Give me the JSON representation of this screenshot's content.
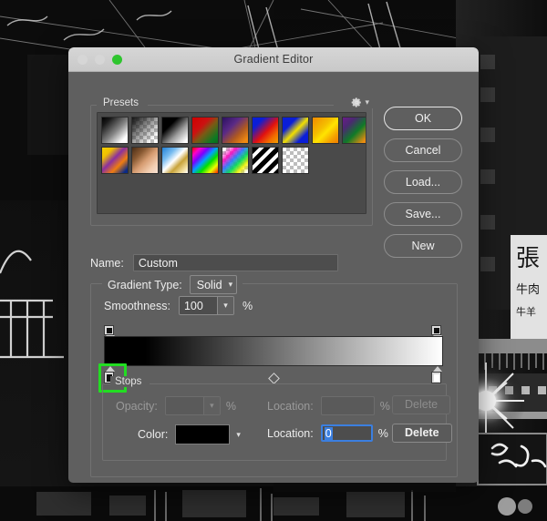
{
  "window": {
    "title": "Gradient Editor",
    "traffic_lights": [
      {
        "name": "close",
        "color": "#d6d6d6"
      },
      {
        "name": "minimize",
        "color": "#d6d6d6"
      },
      {
        "name": "maximize",
        "color": "#2ec52e"
      }
    ]
  },
  "presets": {
    "label": "Presets",
    "menu_icon": "gear-icon",
    "swatches": [
      {
        "name": "foreground-to-background",
        "css": "linear-gradient(135deg,#000 0%,#1a1a1a 18%,#888 55%,#fff 85%,#fff 100%)",
        "checker": false
      },
      {
        "name": "foreground-to-transparent",
        "css": "linear-gradient(135deg,#111 0%,rgba(60,60,60,0.55) 45%,rgba(255,255,255,0) 85%)",
        "checker": true
      },
      {
        "name": "black-white",
        "css": "linear-gradient(135deg,#000 0%,#000 30%,#9a9a9a 62%,#fff 92%)",
        "checker": false
      },
      {
        "name": "red-green",
        "css": "linear-gradient(135deg,#d00000 0%,#cc1111 35%,#7a5a14 55%,#0a7a22 85%,#0a6b1e 100%)",
        "checker": false
      },
      {
        "name": "violet-orange",
        "css": "linear-gradient(135deg,#2b1060 0%,#5a2a86 35%,#b05a20 65%,#f08a12 90%)",
        "checker": false
      },
      {
        "name": "blue-red-yellow",
        "css": "linear-gradient(135deg,#0a1ed8 0%,#0a1ed8 22%,#e01010 55%,#f26a00 78%,#f2a000 100%)",
        "checker": false
      },
      {
        "name": "blue-yellow-blue",
        "css": "linear-gradient(135deg,#0a1ed8 0%,#0a1ed8 28%,#f2e000 52%,#0a1ed8 78%,#0a1ed8 100%)",
        "checker": false
      },
      {
        "name": "orange-yellow-orange",
        "css": "linear-gradient(135deg,#f08a00 0%,#f5c000 40%,#ffe400 55%,#f5a000 80%,#ef7d00 100%)",
        "checker": false
      },
      {
        "name": "violet-green-orange",
        "css": "linear-gradient(135deg,#6a1b8a 0%,#4a2a70 25%,#0f7a28 55%,#eb8c10 88%)",
        "checker": false
      },
      {
        "name": "yellow-violet-orange-blue",
        "css": "linear-gradient(135deg,#f5d000 0%,#f0c000 22%,#8a2fa0 45%,#ef7d10 68%,#0a2a86 92%)",
        "checker": false
      },
      {
        "name": "copper",
        "css": "linear-gradient(135deg,#4a2c16 0%,#8a5a33 28%,#d79d72 52%,#f2cdb0 78%,#f7e3d4 100%)",
        "checker": false
      },
      {
        "name": "chrome",
        "css": "linear-gradient(135deg,#1f7fd6 0%,#79bdf0 28%,#ffffff 48%,#c8a33a 66%,#f3e0a0 86%,#ffffff 100%)",
        "checker": false
      },
      {
        "name": "spectrum",
        "css": "linear-gradient(135deg,#ff0000 0%,#ff00c8 16%,#7a00ff 32%,#00a0ff 48%,#00e000 64%,#e8ff00 82%,#ff2000 100%)",
        "checker": false
      },
      {
        "name": "transparent-rainbow",
        "css": "linear-gradient(135deg,rgba(255,0,0,0) 8%,rgba(255,0,190,0.85) 28%,rgba(40,120,255,0.9) 45%,rgba(0,220,80,0.9) 62%,rgba(240,240,0,0.9) 78%,rgba(255,255,255,0) 96%)",
        "checker": true
      },
      {
        "name": "transparent-stripes",
        "css": "repeating-linear-gradient(135deg,#000 0 5px,#fff 5px 9px)",
        "checker": false
      },
      {
        "name": "transparent-to-transparent",
        "css": "linear-gradient(135deg,rgba(255,255,255,0) 0%,rgba(255,255,255,0) 100%)",
        "checker": true
      }
    ]
  },
  "buttons": [
    {
      "name": "ok-button",
      "label": "OK",
      "default": true
    },
    {
      "name": "cancel-button",
      "label": "Cancel",
      "default": false
    },
    {
      "name": "load-button",
      "label": "Load...",
      "default": false
    },
    {
      "name": "save-button",
      "label": "Save...",
      "default": false
    },
    {
      "name": "new-button",
      "label": "New",
      "default": false
    }
  ],
  "name_field": {
    "label": "Name:",
    "value": "Custom"
  },
  "gradient_type": {
    "label": "Gradient Type:",
    "value": "Solid",
    "chevron": "chevron-down-icon"
  },
  "smoothness": {
    "label": "Smoothness:",
    "value": "100",
    "unit": "%",
    "chevron": "chevron-down-icon"
  },
  "gradient_bar": {
    "css": "linear-gradient(to right,#000 0%,#000 12%,#ffffff 100%)",
    "opacity_stops": [
      {
        "name": "opacity-stop-left",
        "location_pct": 0
      },
      {
        "name": "opacity-stop-right",
        "location_pct": 100
      }
    ],
    "color_stops": [
      {
        "name": "color-stop-black",
        "location_pct": 0,
        "color": "#000000",
        "selected": true
      },
      {
        "name": "color-stop-white",
        "location_pct": 100,
        "color": "#ffffff",
        "selected": false
      }
    ],
    "midpoint_pct": 50,
    "selection_highlight_color": "#22dd22"
  },
  "stops": {
    "label": "Stops",
    "opacity": {
      "label": "Opacity:",
      "value": "",
      "unit": "%",
      "enabled": false
    },
    "opacity_location": {
      "label": "Location:",
      "value": "",
      "unit": "%",
      "enabled": false
    },
    "opacity_delete": {
      "label": "Delete",
      "enabled": false
    },
    "color": {
      "label": "Color:",
      "swatch_color": "#000000",
      "chevron": "chevron-down-icon"
    },
    "color_location": {
      "label": "Location:",
      "value": "0",
      "unit": "%",
      "enabled": true,
      "focused": true,
      "focus_color": "#3b7fe0"
    },
    "color_delete": {
      "label": "Delete",
      "enabled": true
    }
  }
}
